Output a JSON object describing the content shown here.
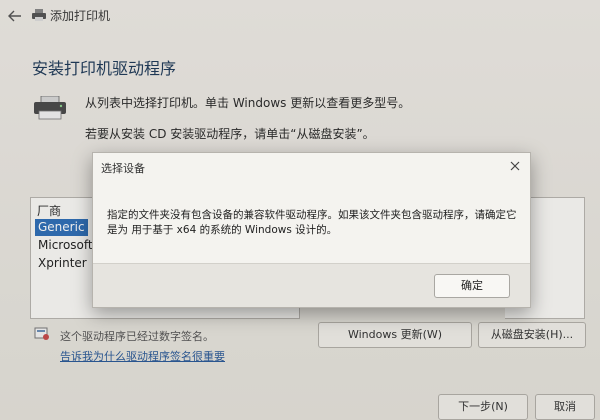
{
  "wizard": {
    "title": "添加打印机",
    "heading": "安装打印机驱动程序",
    "instruction1": "从列表中选择打印机。单击 Windows 更新以查看更多型号。",
    "instruction2": "若要从安装 CD 安装驱动程序，请单击“从磁盘安装”。"
  },
  "manufacturer_list": {
    "header": "厂商",
    "items": [
      "Generic",
      "Microsoft",
      "Xprinter"
    ],
    "selected": "Generic"
  },
  "dialog": {
    "title": "选择设备",
    "message": "指定的文件夹没有包含设备的兼容软件驱动程序。如果该文件夹包含驱动程序，请确定它是为 用于基于 x64 的系统的 Windows 设计的。",
    "ok_label": "确定"
  },
  "signature": {
    "status_text": "这个驱动程序已经过数字签名。",
    "link_text": "告诉我为什么驱动程序签名很重要"
  },
  "buttons": {
    "windows_update": "Windows 更新(W)",
    "have_disk": "从磁盘安装(H)...",
    "next": "下一步(N)",
    "cancel": "取消"
  }
}
